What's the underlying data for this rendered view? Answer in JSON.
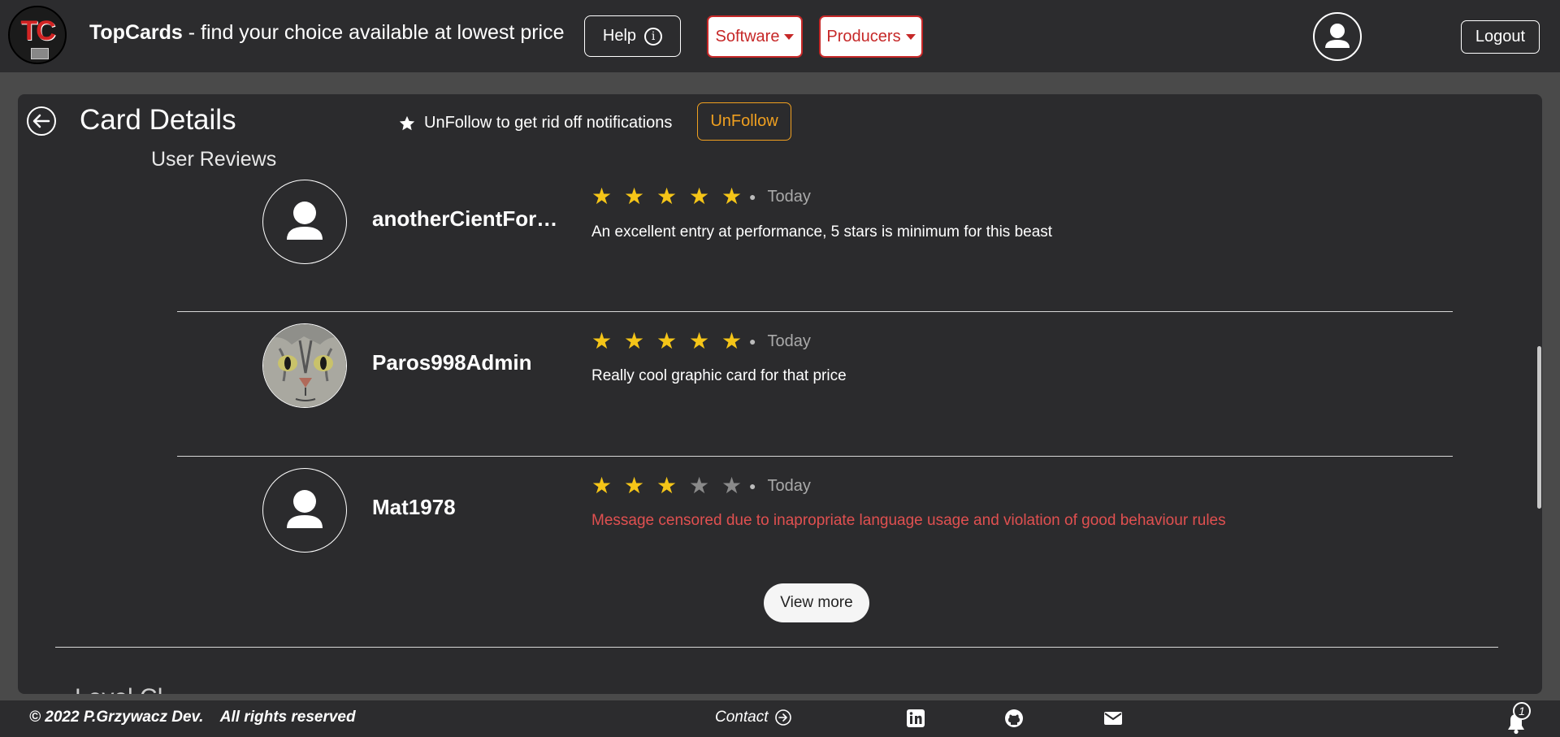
{
  "navbar": {
    "logo_text": "TC",
    "brand_name": "TopCards",
    "brand_tagline": "- find your choice available at lowest price",
    "help_label": "Help",
    "software_label": "Software",
    "producers_label": "Producers",
    "logout_label": "Logout"
  },
  "page": {
    "title": "Card Details",
    "follow_note": "UnFollow to get rid off notifications",
    "unfollow_label": "UnFollow",
    "reviews_title": "User Reviews",
    "view_more_label": "View more",
    "next_section_partial": "Level Cl..."
  },
  "reviews": [
    {
      "name": "anotherCientForR...",
      "rating": 5,
      "max": 5,
      "date": "Today",
      "text": "An excellent entry at performance, 5 stars is minimum for this beast",
      "censored": false,
      "avatar": "default-user"
    },
    {
      "name": "Paros998Admin",
      "rating": 5,
      "max": 5,
      "date": "Today",
      "text": "Really cool graphic card for that price",
      "censored": false,
      "avatar": "cat-photo"
    },
    {
      "name": "Mat1978",
      "rating": 3,
      "max": 5,
      "date": "Today",
      "text": "Message censored due to inapropriate language usage and violation of good behaviour rules",
      "censored": true,
      "avatar": "default-user"
    }
  ],
  "footer": {
    "copyright": "© 2022 P.Grzywacz Dev.    All rights reserved",
    "contact_label": "Contact",
    "notification_count": "1",
    "icons": [
      "linkedin-icon",
      "github-icon",
      "mail-icon",
      "bell-icon"
    ]
  },
  "colors": {
    "navbar_bg": "#2c2c2e",
    "card_bg": "#2b2b2d",
    "accent_red": "#c62828",
    "accent_orange": "#f0a020",
    "star_on": "#f5c518",
    "censored_text": "#e05050"
  }
}
